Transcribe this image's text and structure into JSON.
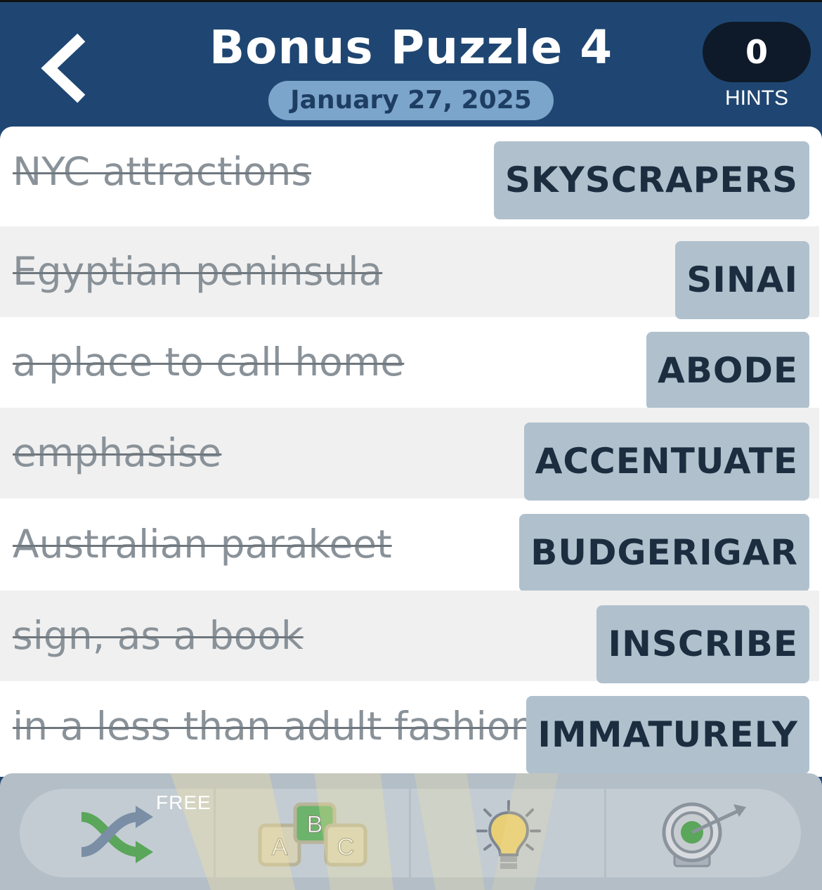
{
  "header": {
    "title": "Bonus Puzzle 4",
    "date": "January 27, 2025",
    "hints_count": "0",
    "hints_label": "HINTS"
  },
  "clues": [
    {
      "clue": "NYC attractions",
      "answer": "SKYSCRAPERS"
    },
    {
      "clue": "Egyptian peninsula",
      "answer": "SINAI"
    },
    {
      "clue": "a place to call home",
      "answer": "ABODE"
    },
    {
      "clue": "emphasise",
      "answer": "ACCENTUATE"
    },
    {
      "clue": "Australian parakeet",
      "answer": "BUDGERIGAR"
    },
    {
      "clue": "sign, as a book",
      "answer": "INSCRIBE"
    },
    {
      "clue": "in a less than adult fashion",
      "answer": "IMMATURELY"
    }
  ],
  "toolbar": {
    "shuffle_badge": "FREE",
    "letters_icon": [
      "A",
      "B",
      "C"
    ],
    "icons": [
      "shuffle-icon",
      "letter-blocks-icon",
      "lightbulb-icon",
      "target-icon"
    ]
  },
  "colors": {
    "header_bg": "#1f4672",
    "date_pill": "#7ba5cb",
    "answer_tile": "#b0c1cd",
    "toolbar_bg": "#b3bec7"
  }
}
